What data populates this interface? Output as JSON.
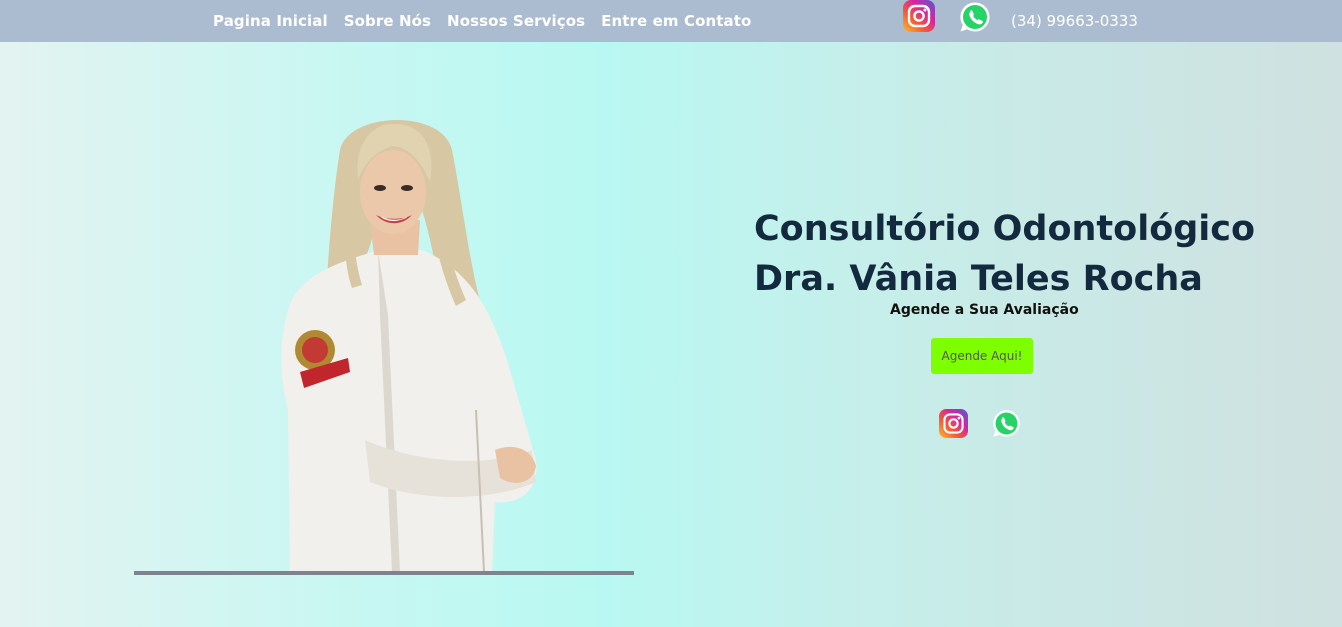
{
  "nav": {
    "items": [
      {
        "label": "Pagina Inicial"
      },
      {
        "label": "Sobre Nós"
      },
      {
        "label": "Nossos Serviços"
      },
      {
        "label": "Entre em Contato"
      }
    ],
    "instagram_icon": "instagram-icon",
    "whatsapp_icon": "whatsapp-icon",
    "phone": "(34) 99663-0333"
  },
  "hero": {
    "title_line1": "Consultório Odontológico",
    "title_line2": "Dra. Vânia Teles Rocha",
    "subtitle": "Agende a Sua Avaliação",
    "cta_label": "Agende Aqui!",
    "social_icons": [
      "instagram-icon",
      "whatsapp-icon"
    ]
  },
  "colors": {
    "topbar": "#abbcd1",
    "title": "#13293d",
    "cta_background": "#7dff00",
    "whatsapp": "#25d366"
  }
}
